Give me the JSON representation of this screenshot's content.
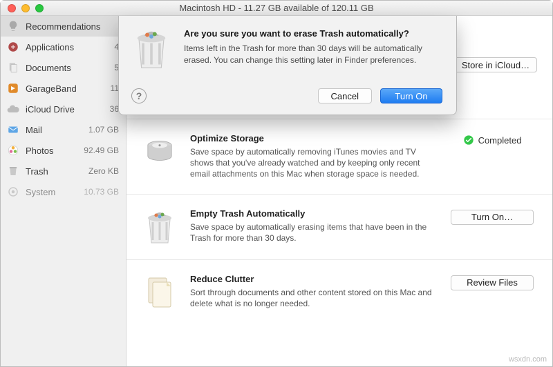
{
  "window": {
    "title": "Macintosh HD - 11.27 GB available of 120.11 GB"
  },
  "sidebar": {
    "items": [
      {
        "label": "Recommendations",
        "size": ""
      },
      {
        "label": "Applications",
        "size": "4"
      },
      {
        "label": "Documents",
        "size": "5"
      },
      {
        "label": "GarageBand",
        "size": "11"
      },
      {
        "label": "iCloud Drive",
        "size": "36"
      },
      {
        "label": "Mail",
        "size": "1.07 GB"
      },
      {
        "label": "Photos",
        "size": "92.49 GB"
      },
      {
        "label": "Trash",
        "size": "Zero KB"
      },
      {
        "label": "System",
        "size": "10.73 GB"
      }
    ]
  },
  "dialog": {
    "title": "Are you sure you want to erase Trash automatically?",
    "body": "Items left in the Trash for more than 30 days will be automatically erased. You can change this setting later in Finder preferences.",
    "help": "?",
    "cancel": "Cancel",
    "confirm": "Turn On"
  },
  "sections": {
    "store_icloud_button": "Store in iCloud…",
    "optimize": {
      "title": "Optimize Storage",
      "body": "Save space by automatically removing iTunes movies and TV shows that you've already watched and by keeping only recent email attachments on this Mac when storage space is needed.",
      "status": "Completed"
    },
    "trash": {
      "title": "Empty Trash Automatically",
      "body": "Save space by automatically erasing items that have been in the Trash for more than 30 days.",
      "button": "Turn On…"
    },
    "clutter": {
      "title": "Reduce Clutter",
      "body": "Sort through documents and other content stored on this Mac and delete what is no longer needed.",
      "button": "Review Files"
    }
  },
  "watermark": "wsxdn.com"
}
